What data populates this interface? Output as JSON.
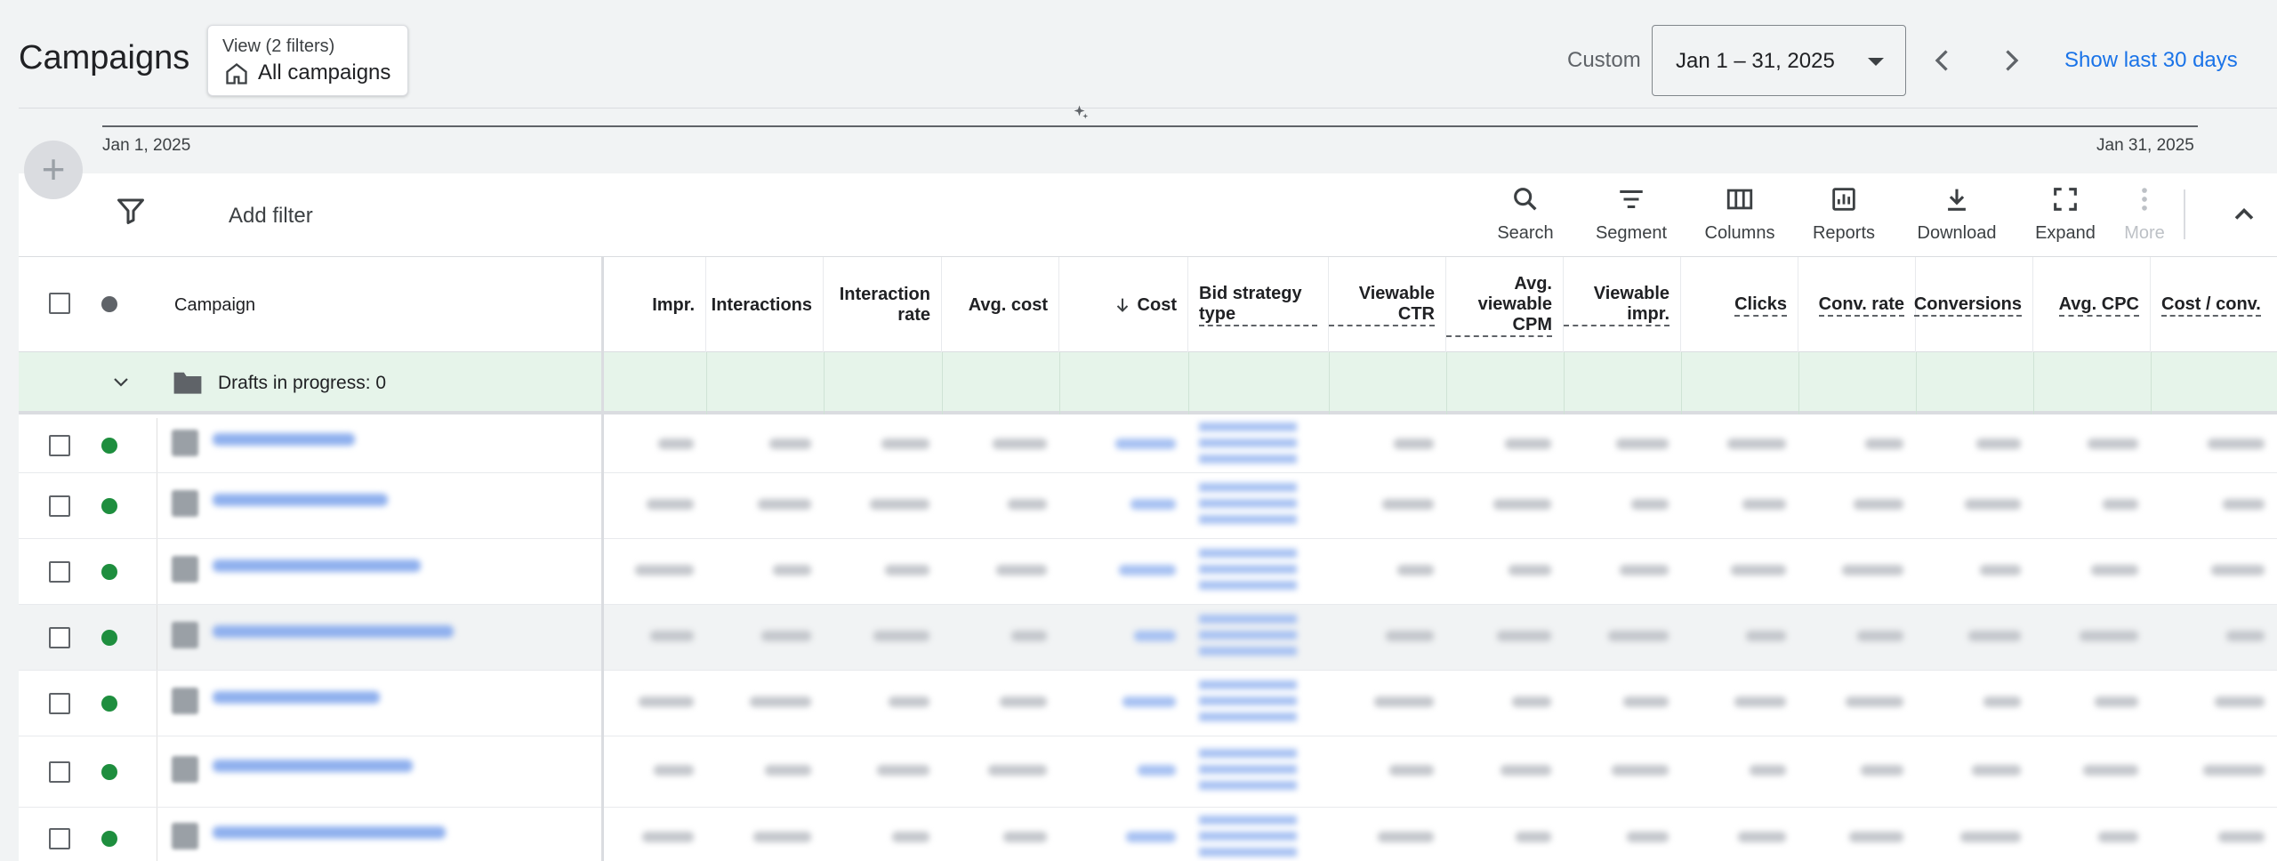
{
  "header": {
    "title": "Campaigns",
    "view": {
      "subtitle": "View (2 filters)",
      "label": "All campaigns"
    },
    "custom_label": "Custom",
    "date_range": "Jan 1 – 31, 2025",
    "show_last": "Show last 30 days"
  },
  "timeline": {
    "start": "Jan 1, 2025",
    "end": "Jan 31, 2025"
  },
  "toolbar": {
    "add_filter": "Add filter",
    "tools": [
      {
        "label": "Search",
        "icon": "search-icon"
      },
      {
        "label": "Segment",
        "icon": "segment-icon"
      },
      {
        "label": "Columns",
        "icon": "columns-icon"
      },
      {
        "label": "Reports",
        "icon": "reports-icon"
      },
      {
        "label": "Download",
        "icon": "download-icon"
      },
      {
        "label": "Expand",
        "icon": "expand-icon"
      },
      {
        "label": "More",
        "icon": "more-vert-icon"
      }
    ]
  },
  "table": {
    "columns": {
      "campaign": "Campaign",
      "impr": "Impr.",
      "interactions": "Interactions",
      "interaction_rate": "Interaction rate",
      "avg_cost": "Avg. cost",
      "cost": "Cost",
      "bid_strategy": "Bid strategy type",
      "viewable_ctr": "Viewable CTR",
      "avg_viewable_cpm": "Avg. viewable CPM",
      "viewable_impr": "Viewable impr.",
      "clicks": "Clicks",
      "conv_rate": "Conv. rate",
      "conversions": "Conversions",
      "avg_cpc": "Avg. CPC",
      "cost_conv": "Cost / conv."
    },
    "drafts": "Drafts in progress: 0",
    "status_color": "#1e8e3e"
  },
  "colors": {
    "accent": "#1a73e8",
    "enabled": "#1e8e3e",
    "drafts_bg": "#e6f4ea"
  }
}
